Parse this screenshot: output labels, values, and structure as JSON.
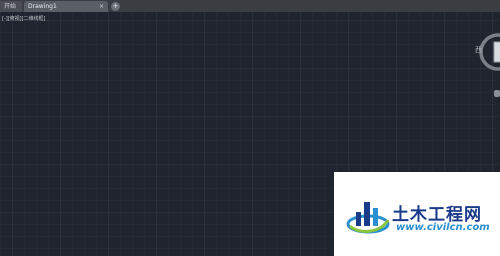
{
  "tabs": [
    {
      "label": "开始"
    },
    {
      "label": "Drawing1",
      "close": "×"
    }
  ],
  "tab_add": "+",
  "viewport_controls": "[-][俯视][二维线框]",
  "viewcube": {
    "compass_label": "西"
  },
  "watermark": {
    "title": "土木工程网",
    "url": "www.civilcn.com"
  }
}
